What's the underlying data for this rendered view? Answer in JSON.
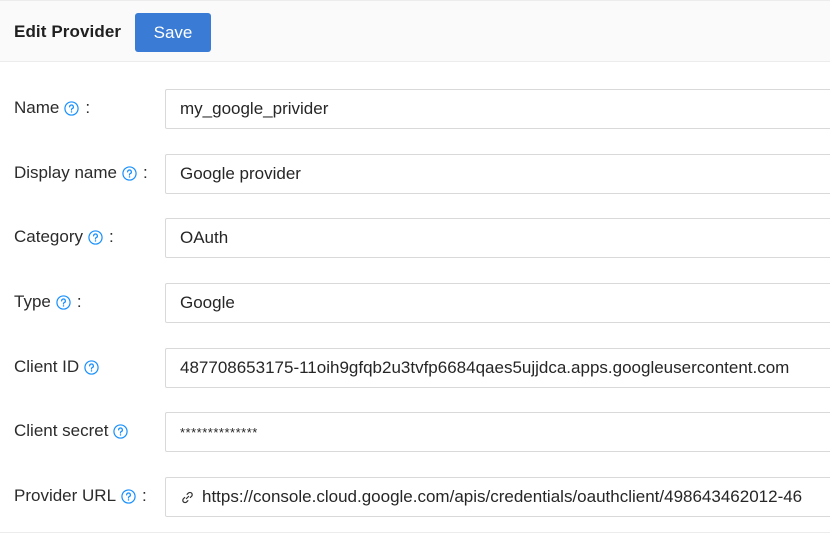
{
  "header": {
    "title": "Edit Provider",
    "save_label": "Save"
  },
  "colors": {
    "accent": "#3a7bd5",
    "help_icon": "#1890ff"
  },
  "form": {
    "fields": [
      {
        "label": "Name",
        "has_colon": true,
        "value": "my_google_privider",
        "icon": "help-circle-icon"
      },
      {
        "label": "Display name",
        "has_colon": true,
        "value": "Google provider",
        "icon": "help-circle-icon"
      },
      {
        "label": "Category",
        "has_colon": true,
        "value": "OAuth",
        "icon": "help-circle-icon"
      },
      {
        "label": "Type",
        "has_colon": true,
        "value": "Google",
        "icon": "help-circle-icon"
      },
      {
        "label": "Client ID",
        "has_colon": false,
        "value": "487708653175-11oih9gfqb2u3tvfp6684qaes5ujjdca.apps.googleusercontent.com",
        "icon": "help-circle-icon"
      },
      {
        "label": "Client secret",
        "has_colon": false,
        "value": "**************",
        "icon": "help-circle-icon"
      },
      {
        "label": "Provider URL",
        "has_colon": true,
        "value": "https://console.cloud.google.com/apis/credentials/oauthclient/498643462012-46",
        "icon": "help-circle-icon",
        "prefix_icon": "link-icon"
      }
    ],
    "colon": ":"
  }
}
